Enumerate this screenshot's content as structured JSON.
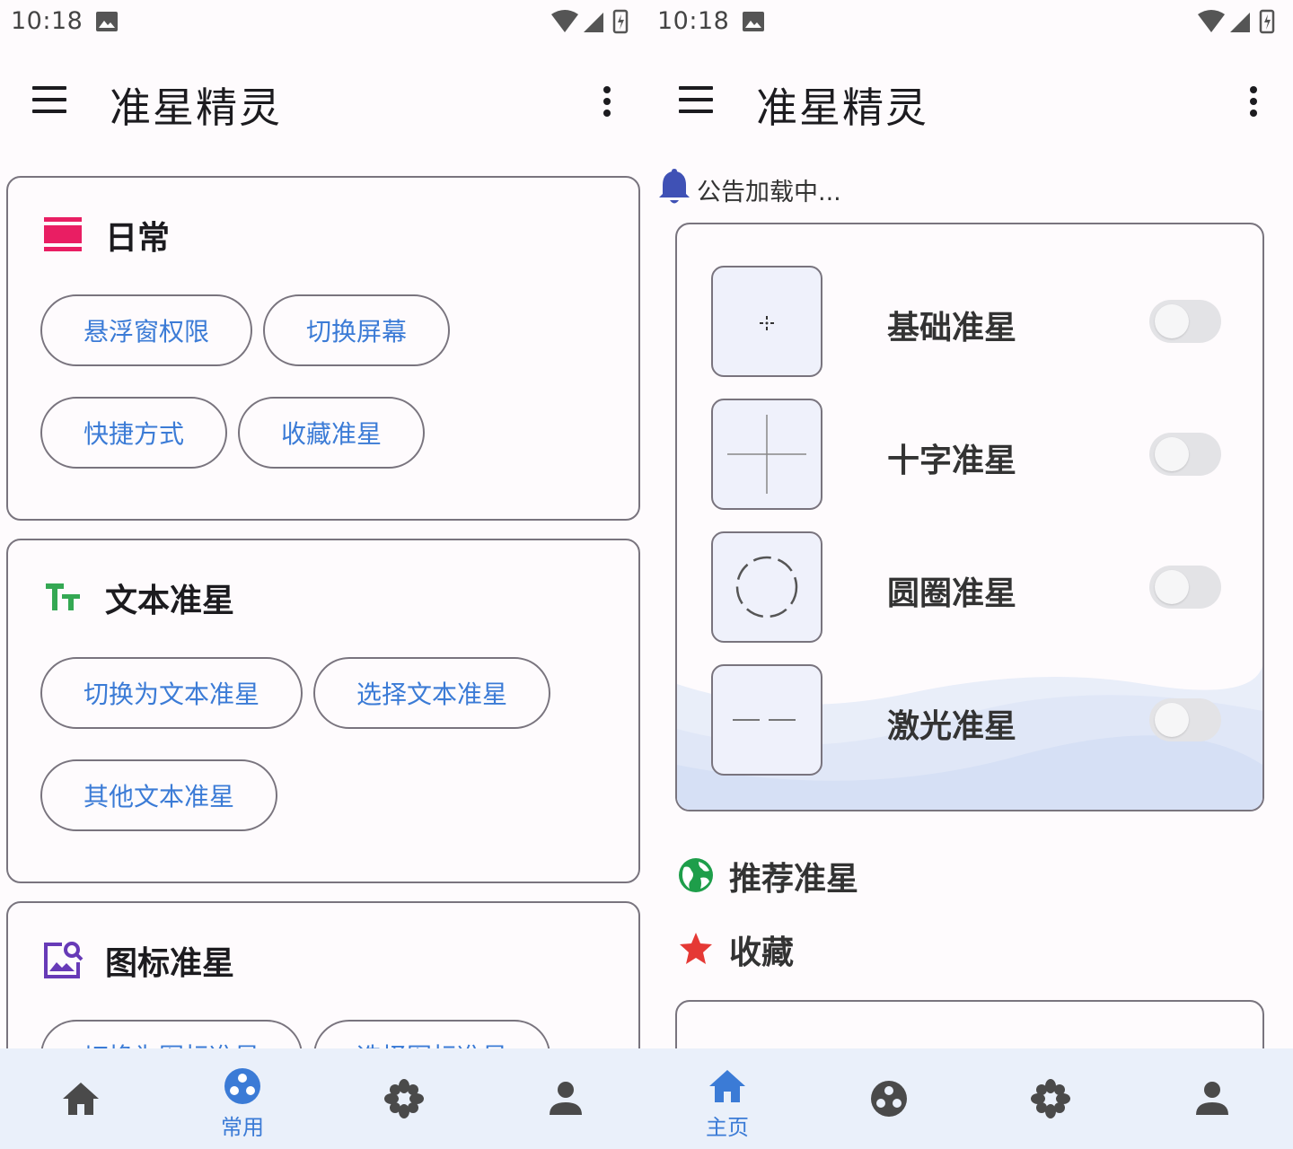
{
  "status_bar": {
    "time": "10:18"
  },
  "app": {
    "title": "准星精灵"
  },
  "left": {
    "cards": [
      {
        "title": "日常",
        "chips": [
          "悬浮窗权限",
          "切换屏幕",
          "快捷方式",
          "收藏准星"
        ]
      },
      {
        "title": "文本准星",
        "chips": [
          "切换为文本准星",
          "选择文本准星",
          "其他文本准星"
        ]
      },
      {
        "title": "图标准星",
        "chips": [
          "切换为图标准星",
          "选择图标准星"
        ]
      }
    ],
    "nav": {
      "active_label": "常用"
    }
  },
  "right": {
    "notice": "公告加载中...",
    "crosshairs": [
      {
        "label": "基础准星",
        "enabled": false
      },
      {
        "label": "十字准星",
        "enabled": false
      },
      {
        "label": "圆圈准星",
        "enabled": false
      },
      {
        "label": "激光准星",
        "enabled": false
      }
    ],
    "sections": {
      "recommended": "推荐准星",
      "favorites": "收藏"
    },
    "nav": {
      "active_label": "主页"
    }
  },
  "colors": {
    "accent": "#3b7bd6",
    "daily_icon": "#e91e63",
    "text_icon": "#34a853",
    "image_icon": "#673ab7",
    "bell": "#3f51b5",
    "globe": "#1e9e4a",
    "star": "#e53935",
    "nav_bg": "#eaf0fa"
  },
  "icons": {
    "daily": "view-agenda-icon",
    "text": "text-fields-icon",
    "image": "image-search-icon",
    "notice": "bell-icon",
    "recommended": "globe-icon",
    "favorites": "star-icon"
  }
}
